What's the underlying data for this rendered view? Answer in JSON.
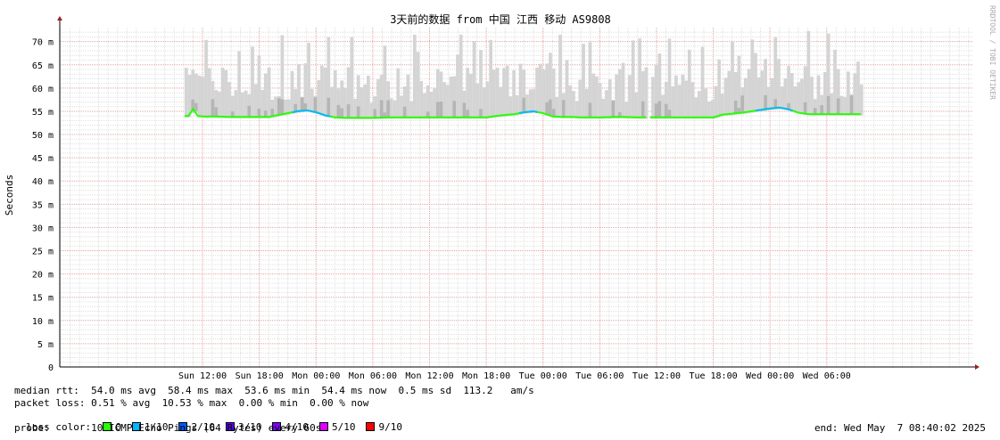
{
  "chart_data": {
    "type": "line",
    "title": "3天前的数据 from 中国 江西 移动 AS9808",
    "ylabel": "Seconds",
    "xlabel": "",
    "watermark": "RRDTOOL / TOBI OETIKER",
    "ylim": [
      0,
      73
    ],
    "y_unit": "ms",
    "y_ticks": [
      {
        "value": 0,
        "label": "0"
      },
      {
        "value": 5,
        "label": "5 m"
      },
      {
        "value": 10,
        "label": "10 m"
      },
      {
        "value": 15,
        "label": "15 m"
      },
      {
        "value": 20,
        "label": "20 m"
      },
      {
        "value": 25,
        "label": "25 m"
      },
      {
        "value": 30,
        "label": "30 m"
      },
      {
        "value": 35,
        "label": "35 m"
      },
      {
        "value": 40,
        "label": "40 m"
      },
      {
        "value": 45,
        "label": "45 m"
      },
      {
        "value": 50,
        "label": "50 m"
      },
      {
        "value": 55,
        "label": "55 m"
      },
      {
        "value": 60,
        "label": "60 m"
      },
      {
        "value": 65,
        "label": "65 m"
      },
      {
        "value": 70,
        "label": "70 m"
      }
    ],
    "x_range_hours": [
      -15.1,
      81.4
    ],
    "x_ticks": [
      {
        "hour": 0,
        "label": "Sun 12:00"
      },
      {
        "hour": 6,
        "label": "Sun 18:00"
      },
      {
        "hour": 12,
        "label": "Mon 00:00"
      },
      {
        "hour": 18,
        "label": "Mon 06:00"
      },
      {
        "hour": 24,
        "label": "Mon 12:00"
      },
      {
        "hour": 30,
        "label": "Mon 18:00"
      },
      {
        "hour": 36,
        "label": "Tue 00:00"
      },
      {
        "hour": 42,
        "label": "Tue 06:00"
      },
      {
        "hour": 48,
        "label": "Tue 12:00"
      },
      {
        "hour": 54,
        "label": "Tue 18:00"
      },
      {
        "hour": 60,
        "label": "Wed 00:00"
      },
      {
        "hour": 66,
        "label": "Wed 06:00"
      }
    ],
    "series": [
      {
        "name": "median rtt",
        "x": [
          -1.9,
          -1.5,
          -1.0,
          -0.5,
          0,
          1,
          3,
          5,
          7,
          8,
          9,
          10,
          11,
          12,
          13,
          14,
          15,
          16,
          17,
          18,
          20,
          22,
          24,
          26,
          28,
          30,
          31,
          32,
          33,
          34,
          35,
          36,
          37,
          38,
          39,
          40,
          42,
          44,
          46,
          48,
          50,
          52,
          54,
          55,
          56,
          57,
          58,
          59,
          60,
          61,
          62,
          63,
          64,
          66,
          68
        ],
        "y": [
          54.0,
          54.0,
          55.5,
          54.0,
          53.9,
          53.9,
          53.8,
          53.8,
          53.8,
          54.2,
          54.6,
          55.0,
          55.2,
          54.8,
          54.1,
          53.7,
          53.6,
          53.6,
          53.6,
          53.6,
          53.7,
          53.7,
          53.7,
          53.7,
          53.7,
          53.7,
          54.0,
          54.2,
          54.4,
          54.8,
          55.0,
          54.6,
          53.9,
          53.8,
          53.8,
          53.7,
          53.7,
          53.8,
          53.7,
          53.7,
          53.7,
          53.7,
          53.7,
          54.3,
          54.5,
          54.7,
          55.0,
          55.3,
          55.6,
          55.8,
          55.4,
          54.7,
          54.4,
          54.4,
          54.4
        ]
      }
    ],
    "time_span_hours": [
      -1.9,
      69.6
    ],
    "gap_hours": [
      47.0,
      47.3
    ]
  },
  "stats": {
    "median_rtt_line": "median rtt:  54.0 ms avg  58.4 ms max  53.6 ms min  54.4 ms now  0.5 ms sd  113.2   am/s",
    "packet_loss_line": "packet loss: 0.51 % avg  10.53 % max  0.00 % min  0.00 % now",
    "loss_color_label": "loss color:",
    "probe_line": "probe:       10 ICMP Echo Pings (64 Bytes) every 60s",
    "end_line": "end: Wed May  7 08:40:02 2025"
  },
  "legend": [
    {
      "label": "0",
      "color": "#26ff00"
    },
    {
      "label": "1/10",
      "color": "#00b8ff"
    },
    {
      "label": "2/10",
      "color": "#0059ff"
    },
    {
      "label": "3/10",
      "color": "#5e00ff"
    },
    {
      "label": "4/10",
      "color": "#7e00ff"
    },
    {
      "label": "5/10",
      "color": "#dd00ff"
    },
    {
      "label": "9/10",
      "color": "#ff0000"
    }
  ],
  "colors": {
    "grid_major": "#e8a0a0",
    "grid_minor": "#e0e0e0",
    "smoke_light": "#d4d4d4",
    "smoke_dark": "#b5b5b5",
    "axis": "#000000",
    "arrow": "#a02020"
  }
}
